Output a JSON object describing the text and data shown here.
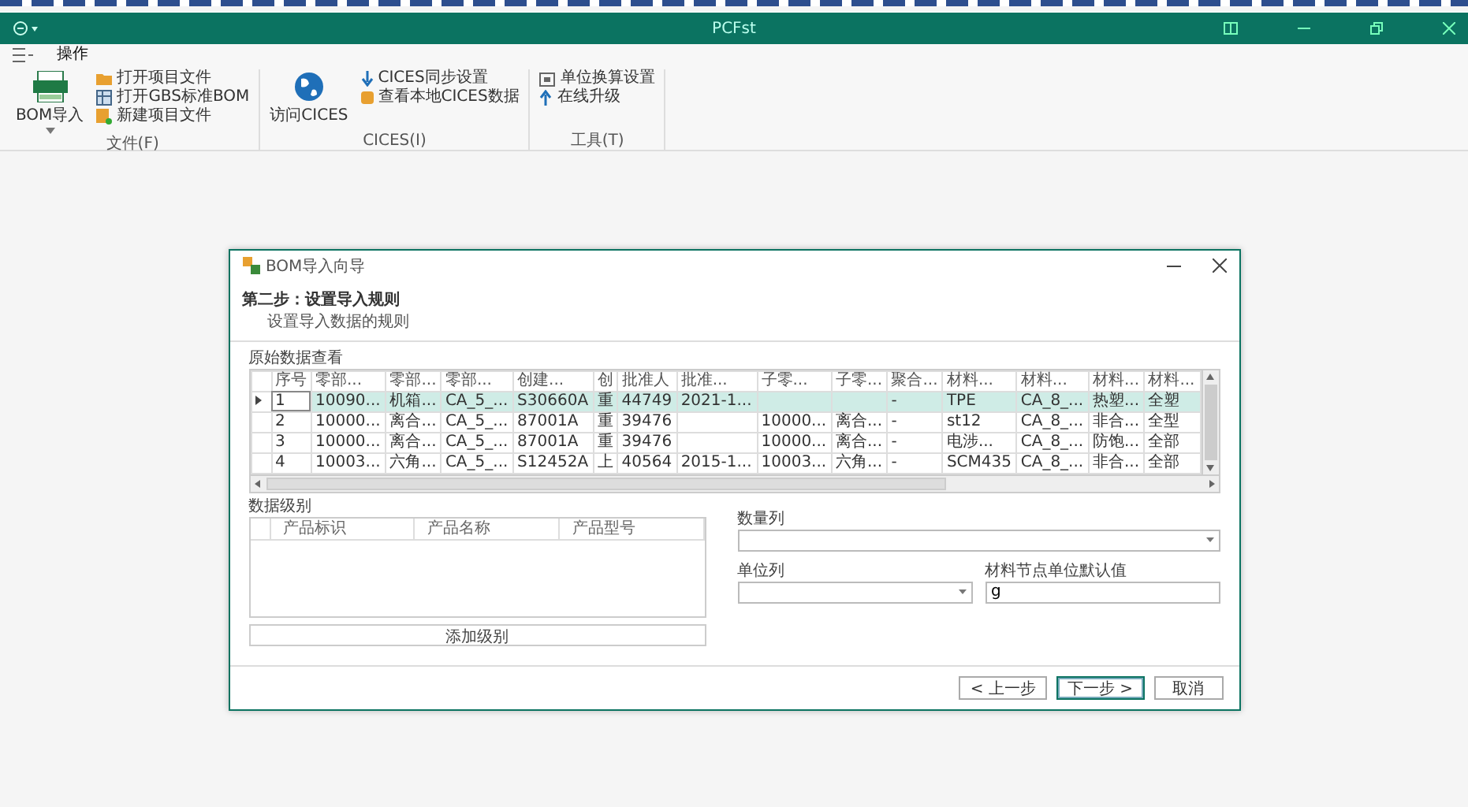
{
  "window": {
    "title": "PCFst"
  },
  "menu": {
    "tabs": [
      {
        "label": "操作",
        "selected": true
      }
    ]
  },
  "ribbon": {
    "groups": [
      {
        "label": "文件(F)",
        "buttons": [
          {
            "label": "BOM导入",
            "kind": "large"
          },
          {
            "label": "打开项目文件",
            "kind": "small"
          },
          {
            "label": "打开GBS标准BOM",
            "kind": "small"
          },
          {
            "label": "新建项目文件",
            "kind": "small"
          }
        ]
      },
      {
        "label": "CICES(I)",
        "buttons": [
          {
            "label": "访问CICES",
            "kind": "large"
          },
          {
            "label": "CICES同步设置",
            "kind": "small"
          },
          {
            "label": "查看本地CICES数据",
            "kind": "small"
          }
        ]
      },
      {
        "label": "工具(T)",
        "buttons": [
          {
            "label": "单位换算设置",
            "kind": "small"
          },
          {
            "label": "在线升级",
            "kind": "small"
          }
        ]
      }
    ]
  },
  "dialog": {
    "title": "BOM导入向导",
    "step_title": "第二步：设置导入规则",
    "step_subtitle": "设置导入数据的规则",
    "source": {
      "label": "原始数据查看",
      "columns": [
        "序号",
        "零部...",
        "零部...",
        "零部...",
        "创建...",
        "创",
        "批准人",
        "批准...",
        "子零...",
        "子零...",
        "聚合...",
        "材料...",
        "材料...",
        "材料...",
        "材料..."
      ],
      "rows": [
        {
          "selected": true,
          "cells": [
            "1",
            "10090...",
            "机箱...",
            "CA_5_...",
            "S30660A",
            "重",
            "44749",
            "2021-1...",
            "",
            "",
            "-",
            "TPE",
            "CA_8_...",
            "热塑...",
            "全塑"
          ]
        },
        {
          "selected": false,
          "cells": [
            "2",
            "10000...",
            "离合...",
            "CA_5_...",
            "87001A",
            "重",
            "39476",
            "",
            "10000...",
            "离合...",
            "-",
            "st12",
            "CA_8_...",
            "非合...",
            "全型"
          ]
        },
        {
          "selected": false,
          "cells": [
            "3",
            "10000...",
            "离合...",
            "CA_5_...",
            "87001A",
            "重",
            "39476",
            "",
            "10000...",
            "离合...",
            "-",
            "电涉...",
            "CA_8_...",
            "防饱...",
            "全部"
          ]
        },
        {
          "selected": false,
          "cells": [
            "4",
            "10003...",
            "六角...",
            "CA_5_...",
            "S12452A",
            "上",
            "40564",
            "2015-1...",
            "10003...",
            "六角...",
            "-",
            "SCM435",
            "CA_8_...",
            "非合...",
            "全部"
          ]
        }
      ]
    },
    "rules": {
      "label": "数据级别",
      "columns": [
        "产品标识",
        "产品名称",
        "产品型号"
      ],
      "add_button": "添加级别"
    },
    "quantity_column": {
      "label": "数量列"
    },
    "unit_column": {
      "label": "单位列"
    },
    "default_unit": {
      "label": "材料节点单位默认值",
      "value": "g"
    },
    "buttons": [
      {
        "label": "< 上一步",
        "focused": false
      },
      {
        "label": "下一步 >",
        "focused": true
      },
      {
        "label": "取消",
        "focused": false
      }
    ]
  }
}
